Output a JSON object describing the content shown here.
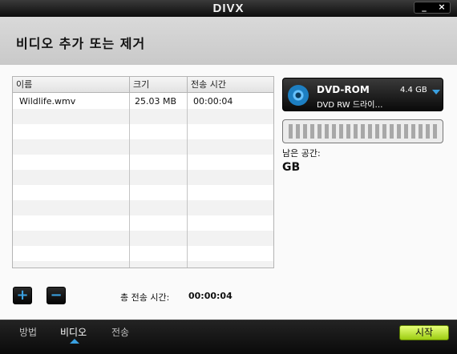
{
  "window": {
    "logo": "DIVX",
    "minimize_label": "_",
    "close_label": "×"
  },
  "header": {
    "title": "비디오 추가 또는 제거"
  },
  "table": {
    "columns": [
      "이름",
      "크기",
      "전송 시간"
    ],
    "rows": [
      [
        "Wildlife.wmv",
        "25.03 MB",
        "00:00:04"
      ]
    ],
    "empty_rows": 11
  },
  "controls": {
    "add_label": "+",
    "remove_label": "−",
    "total_label": "총 전송 시간:",
    "total_value": "00:00:04"
  },
  "drive": {
    "name": "DVD-ROM",
    "size": "4.4 GB",
    "sub": "DVD RW 드라이…"
  },
  "space": {
    "free_label": "남은 공간:",
    "free_value": "GB"
  },
  "footer": {
    "nav": [
      "방법",
      "비디오",
      "전송"
    ],
    "active_index": 1,
    "start_label": "시작"
  },
  "colors": {
    "accent": "#3aa0e0",
    "start_button": "#b6e22a"
  }
}
